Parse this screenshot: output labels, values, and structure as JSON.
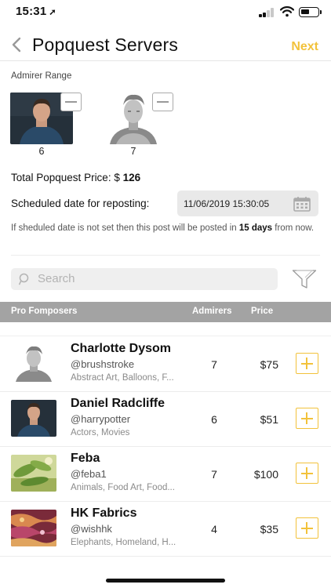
{
  "status_bar": {
    "time": "15:31",
    "location_glyph": "➚"
  },
  "nav": {
    "back_icon": "chevron-left-icon",
    "title": "Popquest Servers",
    "next_label": "Next"
  },
  "admirer_range": {
    "label": "Admirer Range",
    "cards": [
      {
        "count": "6",
        "checked": false
      },
      {
        "count": "7",
        "checked": false
      }
    ]
  },
  "total_price": {
    "label": "Total Popquest Price: $",
    "value": "126"
  },
  "schedule": {
    "label": "Scheduled date for reposting:",
    "value": "11/06/2019 15:30:05",
    "note_prefix": "If sheduled date is not set then this post will be posted in ",
    "note_bold": "15 days",
    "note_suffix": " from now."
  },
  "search": {
    "placeholder": "Search"
  },
  "table": {
    "headers": {
      "name": "Pro Fomposers",
      "admirers": "Admirers",
      "price": "Price"
    },
    "rows": [
      {
        "name": "Charlotte Dysom",
        "handle": "@brushstroke",
        "tags": "Abstract Art, Balloons, F...",
        "admirers": "7",
        "price": "$75"
      },
      {
        "name": "Daniel Radcliffe",
        "handle": "@harrypotter",
        "tags": "Actors, Movies",
        "admirers": "6",
        "price": "$51"
      },
      {
        "name": "Feba",
        "handle": "@feba1",
        "tags": "Animals, Food Art, Food...",
        "admirers": "7",
        "price": "$100"
      },
      {
        "name": "HK Fabrics",
        "handle": "@wishhk",
        "tags": "Elephants, Homeland, H...",
        "admirers": "4",
        "price": "$35"
      }
    ]
  },
  "colors": {
    "accent": "#f2c23b",
    "header_bg": "#a3a3a3",
    "field_bg": "#e9e9e9"
  }
}
